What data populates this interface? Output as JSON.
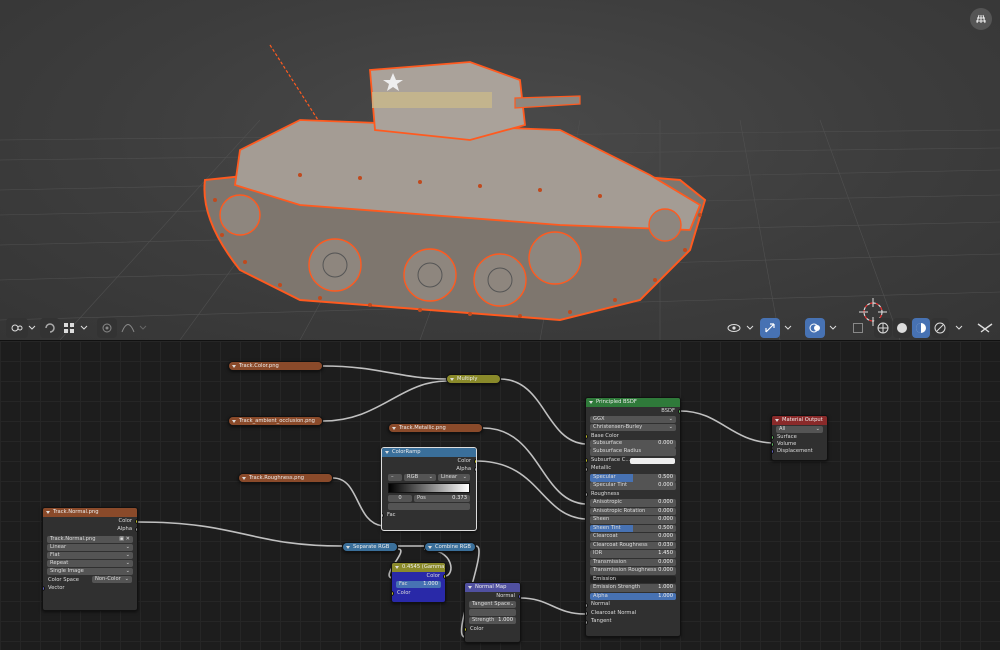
{
  "viewport": {
    "colors": {
      "outline": "#ff5a1f",
      "tank_body": "#9a928a",
      "grid": "#505050"
    },
    "header": {
      "left_icons": [
        "pivot-icon",
        "snap-icon",
        "snap-grid-icon",
        "proportional-edit-icon",
        "falloff-icon"
      ],
      "right_icons": [
        "visibility-icon",
        "gizmo-icon",
        "overlay-icon",
        "xray-icon",
        "wireframe-shading-icon",
        "solid-shading-icon",
        "material-shading-icon",
        "rendered-shading-icon",
        "editor-icon"
      ]
    }
  },
  "nodes": {
    "track_color": {
      "title": "Track.Color.png"
    },
    "track_ao": {
      "title": "Track_ambient_occlusion.png"
    },
    "track_metallic": {
      "title": "Track.Metallic.png"
    },
    "track_roughness": {
      "title": "Track.Roughness.png"
    },
    "multiply": {
      "title": "Multiply"
    },
    "color_ramp": {
      "title": "ColorRamp",
      "outputs": [
        "Color",
        "Alpha"
      ],
      "mode": "RGB",
      "interpolation": "Linear",
      "index": "0",
      "pos_label": "Pos",
      "pos_value": "0.373",
      "input": "Fac"
    },
    "track_normal": {
      "title": "Track.Normal.png",
      "outputs": [
        "Color",
        "Alpha"
      ],
      "image": "Track.Normal.png",
      "selects": [
        "Linear",
        "Flat",
        "Repeat",
        "Single Image"
      ],
      "colorspace_label": "Color Space",
      "colorspace_value": "Non-Color",
      "input": "Vector"
    },
    "separate_rgb": {
      "title": "Separate RGB"
    },
    "combine_rgb": {
      "title": "Combine RGB"
    },
    "gamma": {
      "title": "0.4545 (Gamma)",
      "output": "Color",
      "fac_label": "Fac",
      "fac_value": "1.000",
      "input": "Color"
    },
    "normal_map": {
      "title": "Normal Map",
      "output": "Normal",
      "space": "Tangent Space",
      "strength_label": "Strength",
      "strength_value": "1.000",
      "input": "Color"
    },
    "principled": {
      "title": "Principled BSDF",
      "output": "BSDF",
      "distribution": "GGX",
      "subsurface_method": "Christensen-Burley",
      "base_color": "Base Color",
      "rows": [
        {
          "label": "Subsurface",
          "value": "0.000",
          "kind": "field"
        },
        {
          "label": "Subsurface Radius",
          "value": "",
          "kind": "select"
        },
        {
          "label": "Subsurface C...",
          "value": "",
          "kind": "color"
        },
        {
          "label": "Metallic",
          "value": "",
          "kind": "socket"
        },
        {
          "label": "Specular",
          "value": "0.500",
          "kind": "blue",
          "fill": "50%"
        },
        {
          "label": "Specular Tint",
          "value": "0.000",
          "kind": "field"
        },
        {
          "label": "Roughness",
          "value": "",
          "kind": "socket"
        },
        {
          "label": "Anisotropic",
          "value": "0.000",
          "kind": "field"
        },
        {
          "label": "Anisotropic Rotation",
          "value": "0.000",
          "kind": "field"
        },
        {
          "label": "Sheen",
          "value": "0.000",
          "kind": "field"
        },
        {
          "label": "Sheen Tint",
          "value": "0.500",
          "kind": "blue",
          "fill": "50%"
        },
        {
          "label": "Clearcoat",
          "value": "0.000",
          "kind": "field"
        },
        {
          "label": "Clearcoat Roughness",
          "value": "0.030",
          "kind": "field"
        },
        {
          "label": "IOR",
          "value": "1.450",
          "kind": "field"
        },
        {
          "label": "Transmission",
          "value": "0.000",
          "kind": "field"
        },
        {
          "label": "Transmission Roughness",
          "value": "0.000",
          "kind": "field"
        },
        {
          "label": "Emission",
          "value": "",
          "kind": "dark"
        },
        {
          "label": "Emission Strength",
          "value": "1.000",
          "kind": "field"
        },
        {
          "label": "Alpha",
          "value": "1.000",
          "kind": "blue",
          "fill": "100%"
        },
        {
          "label": "Normal",
          "value": "",
          "kind": "socket"
        },
        {
          "label": "Clearcoat Normal",
          "value": "",
          "kind": "socket"
        },
        {
          "label": "Tangent",
          "value": "",
          "kind": "socket"
        }
      ]
    },
    "material_output": {
      "title": "Material Output",
      "target": "All",
      "inputs": [
        "Surface",
        "Volume",
        "Displacement"
      ]
    }
  }
}
